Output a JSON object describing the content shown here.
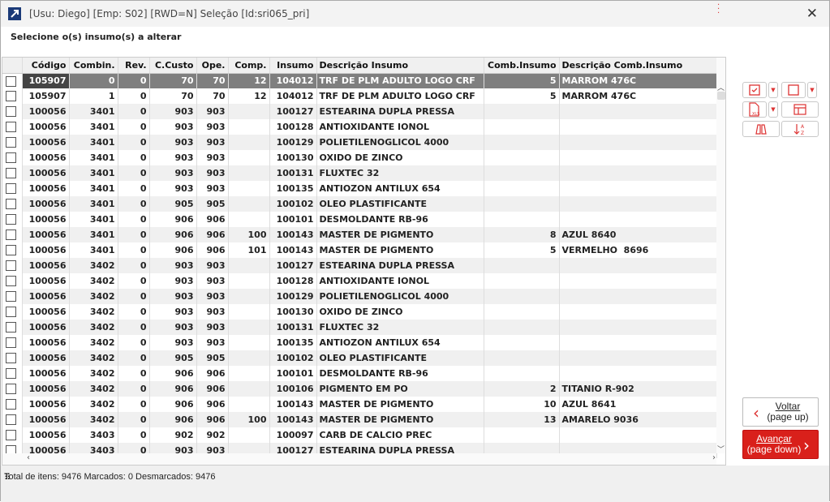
{
  "window": {
    "title": "[Usu: Diego] [Emp: S02] [RWD=N] Seleção [Id:sri065_pri]",
    "close": "✕"
  },
  "subtitle": "Selecione o(s) insumo(s) a alterar",
  "columns": [
    "Código",
    "Combin.",
    "Rev.",
    "C.Custo",
    "Ope.",
    "Comp.",
    "Insumo",
    "Descrição Insumo",
    "Comb.Insumo",
    "Descrição Comb.Insumo"
  ],
  "rows": [
    [
      "105907",
      "0",
      "0",
      "70",
      "70",
      "12",
      "104012",
      "TRF DE PLM ADULTO LOGO CRF",
      "5",
      "MARROM 476C"
    ],
    [
      "105907",
      "1",
      "0",
      "70",
      "70",
      "12",
      "104012",
      "TRF DE PLM ADULTO LOGO CRF",
      "5",
      "MARROM 476C"
    ],
    [
      "100056",
      "3401",
      "0",
      "903",
      "903",
      "",
      "100127",
      "ESTEARINA DUPLA PRESSA",
      "",
      ""
    ],
    [
      "100056",
      "3401",
      "0",
      "903",
      "903",
      "",
      "100128",
      "ANTIOXIDANTE IONOL",
      "",
      ""
    ],
    [
      "100056",
      "3401",
      "0",
      "903",
      "903",
      "",
      "100129",
      "POLIETILENOGLICOL 4000",
      "",
      ""
    ],
    [
      "100056",
      "3401",
      "0",
      "903",
      "903",
      "",
      "100130",
      "OXIDO DE ZINCO",
      "",
      ""
    ],
    [
      "100056",
      "3401",
      "0",
      "903",
      "903",
      "",
      "100131",
      "FLUXTEC 32",
      "",
      ""
    ],
    [
      "100056",
      "3401",
      "0",
      "903",
      "903",
      "",
      "100135",
      "ANTIOZON ANTILUX 654",
      "",
      ""
    ],
    [
      "100056",
      "3401",
      "0",
      "905",
      "905",
      "",
      "100102",
      "OLEO PLASTIFICANTE",
      "",
      ""
    ],
    [
      "100056",
      "3401",
      "0",
      "906",
      "906",
      "",
      "100101",
      "DESMOLDANTE RB-96",
      "",
      ""
    ],
    [
      "100056",
      "3401",
      "0",
      "906",
      "906",
      "100",
      "100143",
      "MASTER DE PIGMENTO",
      "8",
      "AZUL 8640"
    ],
    [
      "100056",
      "3401",
      "0",
      "906",
      "906",
      "101",
      "100143",
      "MASTER DE PIGMENTO",
      "5",
      "VERMELHO  8696"
    ],
    [
      "100056",
      "3402",
      "0",
      "903",
      "903",
      "",
      "100127",
      "ESTEARINA DUPLA PRESSA",
      "",
      ""
    ],
    [
      "100056",
      "3402",
      "0",
      "903",
      "903",
      "",
      "100128",
      "ANTIOXIDANTE IONOL",
      "",
      ""
    ],
    [
      "100056",
      "3402",
      "0",
      "903",
      "903",
      "",
      "100129",
      "POLIETILENOGLICOL 4000",
      "",
      ""
    ],
    [
      "100056",
      "3402",
      "0",
      "903",
      "903",
      "",
      "100130",
      "OXIDO DE ZINCO",
      "",
      ""
    ],
    [
      "100056",
      "3402",
      "0",
      "903",
      "903",
      "",
      "100131",
      "FLUXTEC 32",
      "",
      ""
    ],
    [
      "100056",
      "3402",
      "0",
      "903",
      "903",
      "",
      "100135",
      "ANTIOZON ANTILUX 654",
      "",
      ""
    ],
    [
      "100056",
      "3402",
      "0",
      "905",
      "905",
      "",
      "100102",
      "OLEO PLASTIFICANTE",
      "",
      ""
    ],
    [
      "100056",
      "3402",
      "0",
      "906",
      "906",
      "",
      "100101",
      "DESMOLDANTE RB-96",
      "",
      ""
    ],
    [
      "100056",
      "3402",
      "0",
      "906",
      "906",
      "",
      "100106",
      "PIGMENTO EM PO",
      "2",
      "TITANIO R-902"
    ],
    [
      "100056",
      "3402",
      "0",
      "906",
      "906",
      "",
      "100143",
      "MASTER DE PIGMENTO",
      "10",
      "AZUL 8641"
    ],
    [
      "100056",
      "3402",
      "0",
      "906",
      "906",
      "100",
      "100143",
      "MASTER DE PIGMENTO",
      "13",
      "AMARELO 9036"
    ],
    [
      "100056",
      "3403",
      "0",
      "902",
      "902",
      "",
      "100097",
      "CARB DE CALCIO PREC",
      "",
      ""
    ],
    [
      "100056",
      "3403",
      "0",
      "903",
      "903",
      "",
      "100127",
      "ESTEARINA DUPLA PRESSA",
      "",
      ""
    ]
  ],
  "buttons": {
    "prev_label": "Voltar",
    "prev_sub": "(page up)",
    "next_label": "Avançar",
    "next_sub": "(page down)",
    "xls": "XLS"
  },
  "status": "Total de itens: 9476 Marcados: 0 Desmarcados: 9476",
  "colors": {
    "accent": "#d9201b",
    "selected_row": "#7f7f7f"
  }
}
